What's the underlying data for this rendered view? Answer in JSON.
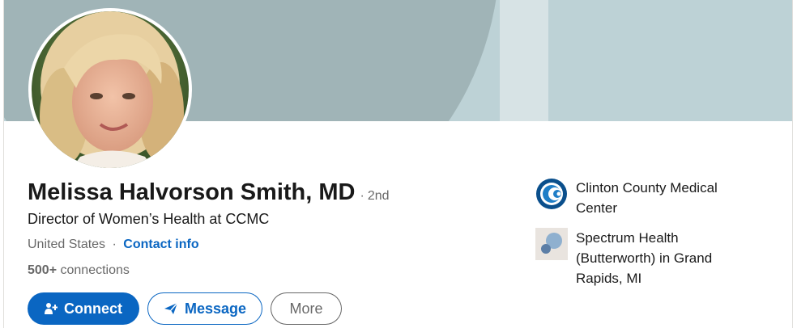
{
  "profile": {
    "name": "Melissa Halvorson Smith, MD",
    "degree": "2nd",
    "degree_separator": "·",
    "headline": "Director of Women’s Health at CCMC",
    "location": "United States",
    "location_separator": "·",
    "contact_info_label": "Contact info",
    "connections_count": "500+",
    "connections_label": "connections"
  },
  "actions": {
    "connect_label": "Connect",
    "message_label": "Message",
    "more_label": "More"
  },
  "organizations": [
    {
      "name": "Clinton County Medical Center",
      "logo_icon": "ccmc-logo-icon"
    },
    {
      "name": "Spectrum Health (Butterworth) in Grand Rapids, MI",
      "logo_icon": "spectrum-health-logo-icon"
    }
  ],
  "colors": {
    "accent": "#0a66c2",
    "banner_dark": "#a0b4b7",
    "banner_light": "#bdd2d6"
  }
}
